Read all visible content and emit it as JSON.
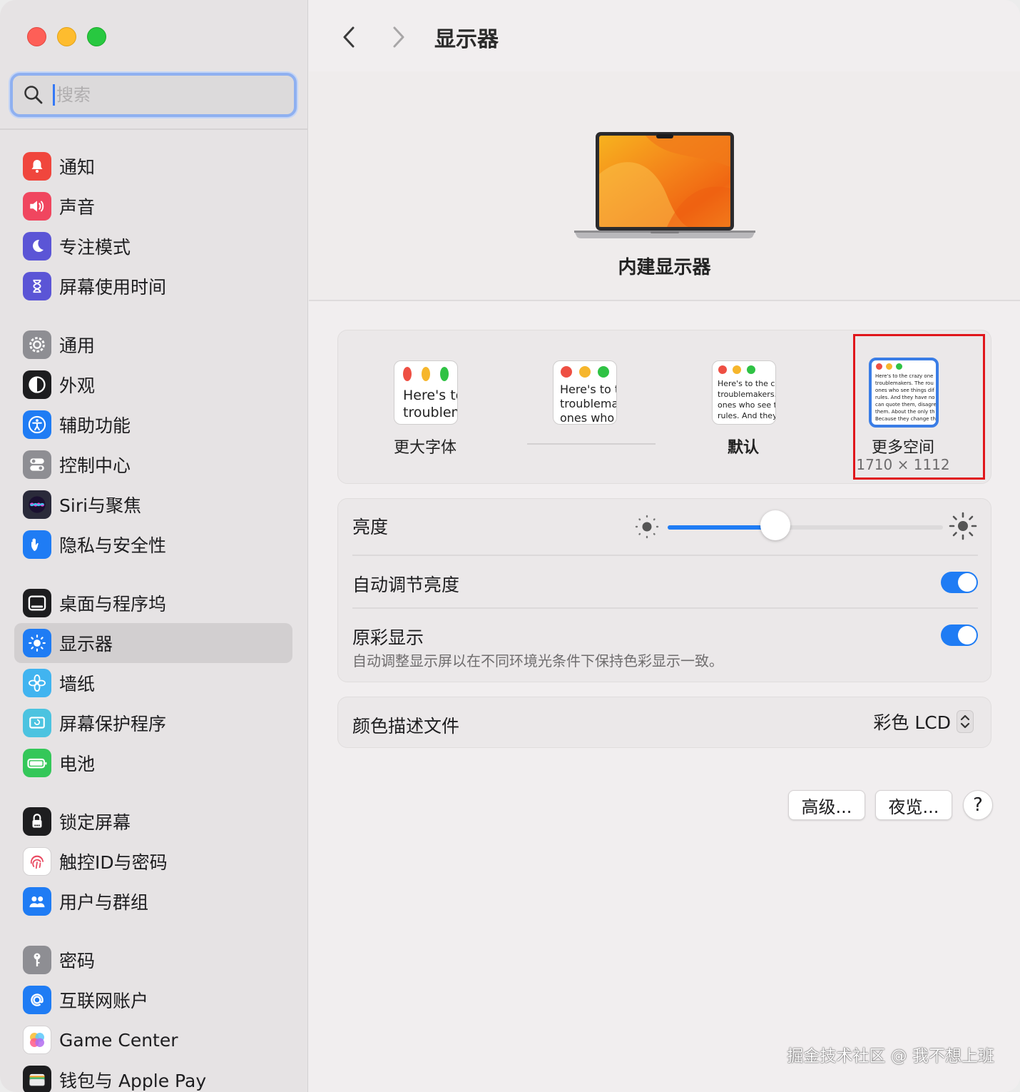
{
  "search": {
    "placeholder": "搜索"
  },
  "sidebar": {
    "items": [
      {
        "label": "通知",
        "icon": "bell-icon",
        "color": "#f0463d"
      },
      {
        "label": "声音",
        "icon": "speaker-icon",
        "color": "#f0465f"
      },
      {
        "label": "专注模式",
        "icon": "moon-icon",
        "color": "#5b55d6"
      },
      {
        "label": "屏幕使用时间",
        "icon": "hourglass-icon",
        "color": "#5b55d6"
      },
      {
        "label": "通用",
        "icon": "gear-icon",
        "color": "#8e8e93"
      },
      {
        "label": "外观",
        "icon": "appearance-icon",
        "color": "#1d1d1f"
      },
      {
        "label": "辅助功能",
        "icon": "accessibility-icon",
        "color": "#1f7cf4"
      },
      {
        "label": "控制中心",
        "icon": "control-center-icon",
        "color": "#8e8e93"
      },
      {
        "label": "Siri与聚焦",
        "icon": "siri-icon",
        "color": "#2a2a3a"
      },
      {
        "label": "隐私与安全性",
        "icon": "hand-icon",
        "color": "#1f7cf4"
      },
      {
        "label": "桌面与程序坞",
        "icon": "dock-icon",
        "color": "#1d1d1f"
      },
      {
        "label": "显示器",
        "icon": "sun-icon",
        "color": "#1f7cf4",
        "selected": true
      },
      {
        "label": "墙纸",
        "icon": "flower-icon",
        "color": "#41b4f0"
      },
      {
        "label": "屏幕保护程序",
        "icon": "screensaver-icon",
        "color": "#4cc3e0"
      },
      {
        "label": "电池",
        "icon": "battery-icon",
        "color": "#34c759"
      },
      {
        "label": "锁定屏幕",
        "icon": "lock-icon",
        "color": "#1d1d1f"
      },
      {
        "label": "触控ID与密码",
        "icon": "fingerprint-icon",
        "color": "#ffffff"
      },
      {
        "label": "用户与群组",
        "icon": "users-icon",
        "color": "#1f7cf4"
      },
      {
        "label": "密码",
        "icon": "key-icon",
        "color": "#8e8e93"
      },
      {
        "label": "互联网账户",
        "icon": "at-icon",
        "color": "#1f7cf4"
      },
      {
        "label": "Game Center",
        "icon": "game-center-icon",
        "color": "#ffffff"
      },
      {
        "label": "钱包与 Apple Pay",
        "icon": "wallet-icon",
        "color": "#1d1d1f"
      }
    ]
  },
  "header": {
    "title": "显示器"
  },
  "hero": {
    "display_name": "内建显示器"
  },
  "resolution": {
    "options": [
      {
        "label": "更大字体",
        "sample": [
          "Here's to",
          "troublem"
        ]
      },
      {
        "label": "",
        "sample": [
          "Here's to t",
          "troublema",
          "ones who"
        ]
      },
      {
        "label": "默认",
        "sample": [
          "Here's to the cr",
          "troublemakers.",
          "ones who see t",
          "rules. And they"
        ]
      },
      {
        "label": "更多空间",
        "sub": "1710 × 1112",
        "sample": [
          "Here's to the crazy one",
          "troublemakers. The rou",
          "ones who see things dif",
          "rules. And they have no",
          "can quote them, disagre",
          "them. About the only th",
          "Because they change th"
        ],
        "selected": true
      }
    ]
  },
  "brightness": {
    "label": "亮度",
    "value": 0.39
  },
  "auto_brightness": {
    "label": "自动调节亮度",
    "on": true
  },
  "true_tone": {
    "label": "原彩显示",
    "description": "自动调整显示屏以在不同环境光条件下保持色彩显示一致。",
    "on": true
  },
  "color_profile": {
    "label": "颜色描述文件",
    "value": "彩色 LCD"
  },
  "buttons": {
    "advanced": "高级...",
    "night_shift": "夜览...",
    "help": "?"
  },
  "watermark": "掘金技术社区 @ 我不想上班",
  "colors": {
    "accent": "#1f7cf4",
    "highlight": "#e0161b"
  }
}
